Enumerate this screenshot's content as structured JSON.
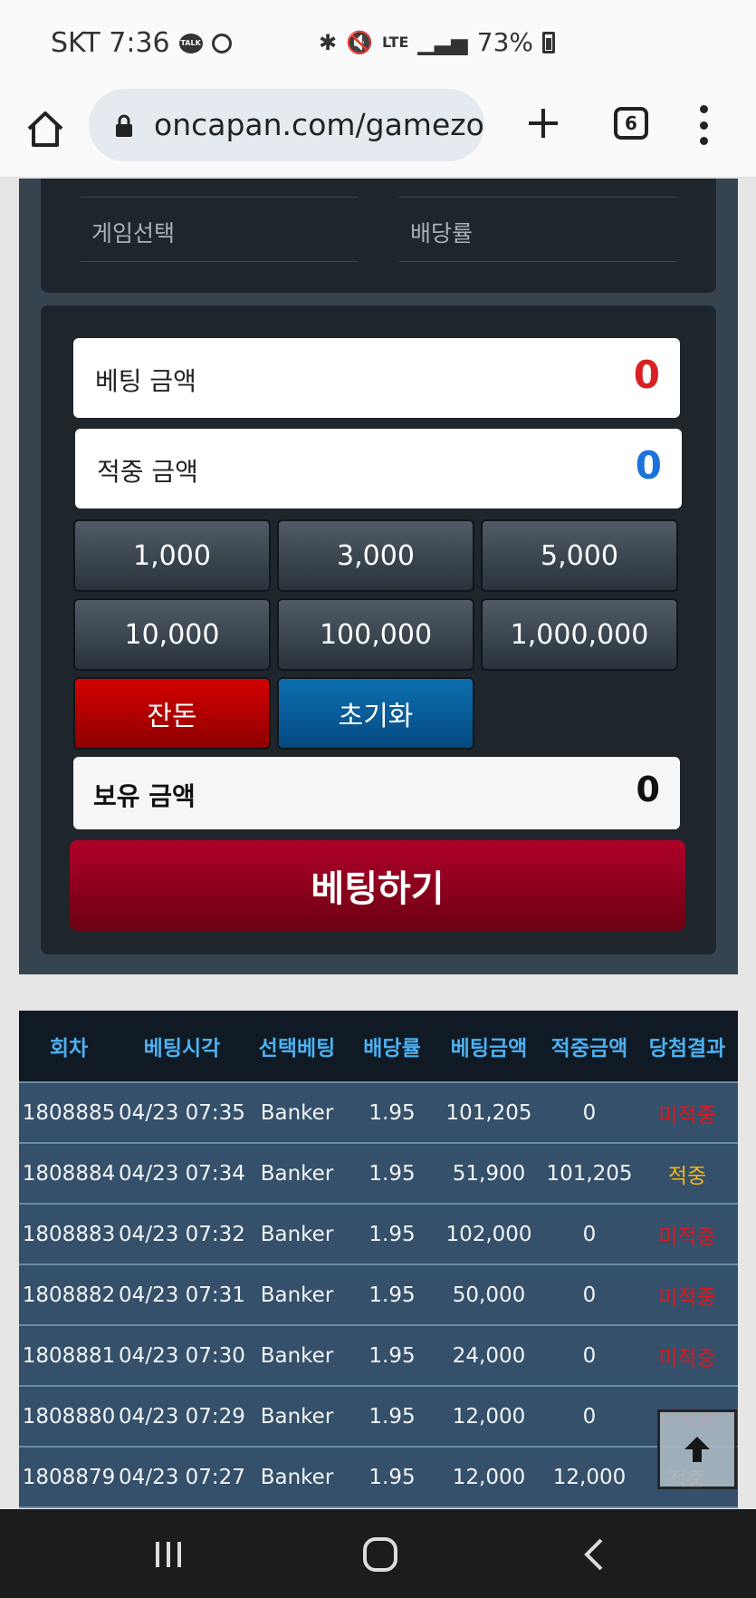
{
  "status_bar": {
    "carrier_time": "SKT 7:36",
    "talk_icon": "TALK",
    "network": "LTE",
    "battery": "73%"
  },
  "browser": {
    "url": "oncapan.com/gamezo",
    "tab_count": "6"
  },
  "top_card": {
    "game_select_label": "게임선택",
    "odds_label": "배당률"
  },
  "betting": {
    "bet_amount_label": "베팅 금액",
    "bet_amount_value": "0",
    "win_amount_label": "적중 금액",
    "win_amount_value": "0",
    "chips": [
      "1,000",
      "3,000",
      "5,000",
      "10,000",
      "100,000",
      "1,000,000"
    ],
    "change_label": "잔돈",
    "reset_label": "초기화",
    "holding_label": "보유 금액",
    "holding_value": "0",
    "bet_button_label": "베팅하기",
    "colors": {
      "bet_value": "#d82020",
      "win_value": "#1a73d9"
    }
  },
  "history": {
    "headers": [
      "회차",
      "베팅시각",
      "선택베팅",
      "배당률",
      "베팅금액",
      "적중금액",
      "당첨결과"
    ],
    "rows": [
      [
        "1808885",
        "04/23 07:35",
        "Banker",
        "1.95",
        "101,205",
        "0",
        "미적중"
      ],
      [
        "1808884",
        "04/23 07:34",
        "Banker",
        "1.95",
        "51,900",
        "101,205",
        "적중"
      ],
      [
        "1808883",
        "04/23 07:32",
        "Banker",
        "1.95",
        "102,000",
        "0",
        "미적중"
      ],
      [
        "1808882",
        "04/23 07:31",
        "Banker",
        "1.95",
        "50,000",
        "0",
        "미적중"
      ],
      [
        "1808881",
        "04/23 07:30",
        "Banker",
        "1.95",
        "24,000",
        "0",
        "미적중"
      ],
      [
        "1808880",
        "04/23 07:29",
        "Banker",
        "1.95",
        "12,000",
        "0",
        "미적중"
      ],
      [
        "1808879",
        "04/23 07:27",
        "Banker",
        "1.95",
        "12,000",
        "12,000",
        "적중"
      ]
    ]
  }
}
